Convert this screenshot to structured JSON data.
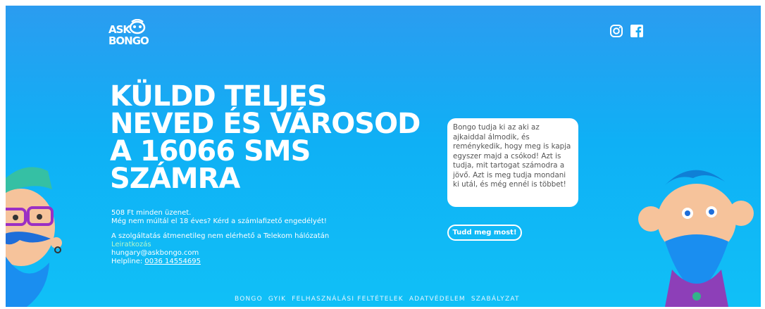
{
  "brand": {
    "line1": "ASK",
    "line2": "BONGO"
  },
  "social": {
    "icons": [
      "instagram-icon",
      "facebook-icon"
    ]
  },
  "headline": {
    "lines": [
      "KÜLDD TELJES",
      "NEVED ÉS VÁROSOD",
      "A 16066 SMS",
      "SZÁMRA"
    ]
  },
  "info": {
    "price": "508 Ft minden üzenet.",
    "age": "Még nem múltál el 18 éves? Kérd a számlafizető engedélyét!",
    "notice": "A szolgáltatás átmenetileg nem elérhető a Telekom hálózatán",
    "unsubscribe": "Leiratkozás",
    "email": "hungary@askbongo.com",
    "helpline_label": "Helpline: ",
    "helpline_number": "0036 14554695"
  },
  "bubble": {
    "text": "Bongo tudja ki az aki az ajkaiddal álmodik, és reménykedik, hogy meg is kapja egyszer majd a csókod! Azt is tudja, mit tartogat számodra a jövő. Azt is meg tudja mondani ki utál, és még ennél is többet!"
  },
  "cta": {
    "label": "Tudd meg most!"
  },
  "footer": {
    "links": [
      "BONGO",
      "GYIK",
      "FELHASZNÁLÁSI FELTÉTELEK",
      "ADATVÉDELEM",
      "SZABÁLYZAT"
    ]
  },
  "colors": {
    "bg_top": "#2b9cf0",
    "bg_bottom": "#10c0f7",
    "text": "#ffffff",
    "unsubscribe": "#b5f8c8"
  }
}
